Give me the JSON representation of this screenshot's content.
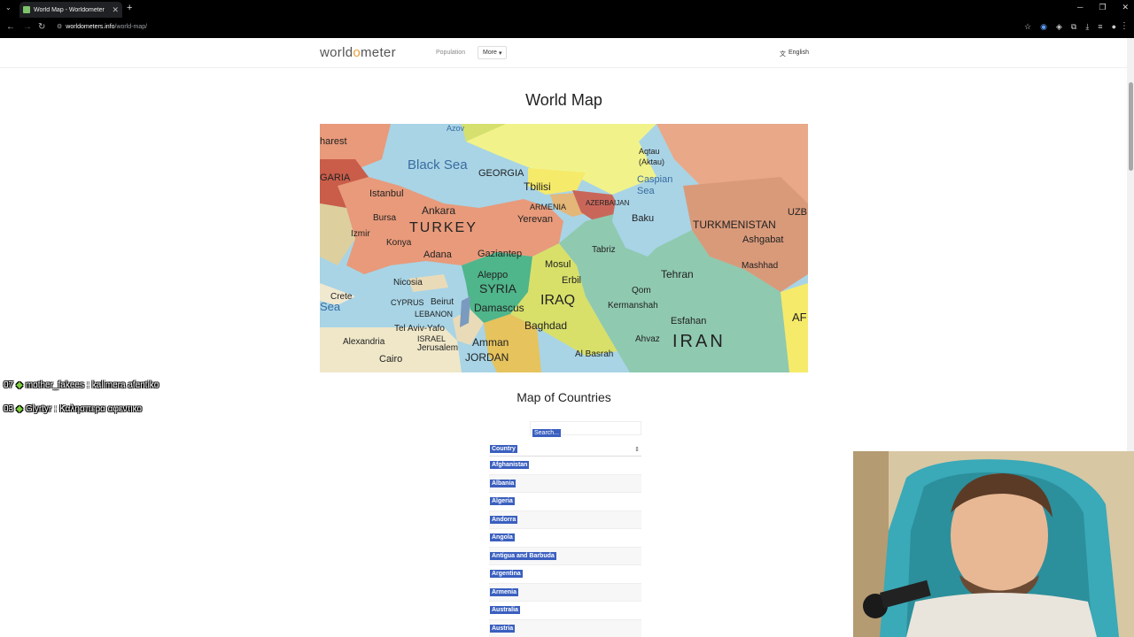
{
  "browser": {
    "tab_title": "World Map - Worldometer",
    "url_host": "worldometers.info",
    "url_path": "/world-map/"
  },
  "site": {
    "logo_prefix": "world",
    "logo_o": "o",
    "logo_suffix": "meter",
    "nav_population": "Population",
    "nav_more": "More",
    "language": "English"
  },
  "page": {
    "title": "World Map",
    "subtitle": "Map of Countries"
  },
  "map": {
    "labels": {
      "black_sea": "Black Sea",
      "caspian_sea": "Caspian Sea",
      "georgia": "GEORGIA",
      "tbilisi": "Tbilisi",
      "armenia": "ARMENIA",
      "azerbaijan": "AZERBAIJAN",
      "yerevan": "Yerevan",
      "baku": "Baku",
      "aqtau": "Aqtau (Aktau)",
      "turkmenistan": "TURKMENISTAN",
      "ashgabat": "Ashgabat",
      "uzb": "UZB",
      "turkey": "TURKEY",
      "ankara": "Ankara",
      "istanbul": "Istanbul",
      "bursa": "Bursa",
      "izmir": "Izmir",
      "konya": "Konya",
      "adana": "Adana",
      "gaziantep": "Gaziantep",
      "tabriz": "Tabriz",
      "mashhad": "Mashhad",
      "tehran": "Tehran",
      "qom": "Qom",
      "kermanshah": "Kermanshah",
      "esfahan": "Esfahan",
      "iran": "IRAN",
      "ahvaz": "Ahvaz",
      "syria": "SYRIA",
      "aleppo": "Aleppo",
      "damascus": "Damascus",
      "iraq": "IRAQ",
      "mosul": "Mosul",
      "erbil": "Erbil",
      "baghdad": "Baghdad",
      "al_basrah": "Al Basrah",
      "nicosia": "Nicosia",
      "cyprus": "CYPRUS",
      "beirut": "Beirut",
      "lebanon": "LEBANON",
      "tel_aviv": "Tel Aviv-Yafo",
      "israel": "ISRAEL",
      "jerusalem": "Jerusalem",
      "amman": "Amman",
      "jordan": "JORDAN",
      "alexandria": "Alexandria",
      "cairo": "Cairo",
      "crete": "Crete",
      "greece": "GARIA",
      "bucharest": "harest",
      "azov": "Azov",
      "af": "AF",
      "sea_left": "Sea"
    }
  },
  "search": {
    "placeholder": "Search..."
  },
  "table": {
    "header": "Country",
    "rows": [
      "Afghanistan",
      "Albania",
      "Algeria",
      "Andorra",
      "Angola",
      "Antigua and Barbuda",
      "Argentina",
      "Armenia",
      "Australia",
      "Austria"
    ]
  },
  "chat": [
    {
      "time": "07",
      "user": "mother_fakees",
      "message": "kalimera afentiko"
    },
    {
      "time": "03",
      "user": "Glyrtyr",
      "message": "Καλησπερα αφεντικο"
    }
  ],
  "colors": {
    "highlight": "#3a5fbf",
    "turkey": "#e89a7a",
    "iran": "#8fc9b0",
    "iraq": "#d8e06a",
    "syria": "#4fb58a",
    "black_sea": "#a8d4e6",
    "turkmenistan": "#d99a7a"
  }
}
